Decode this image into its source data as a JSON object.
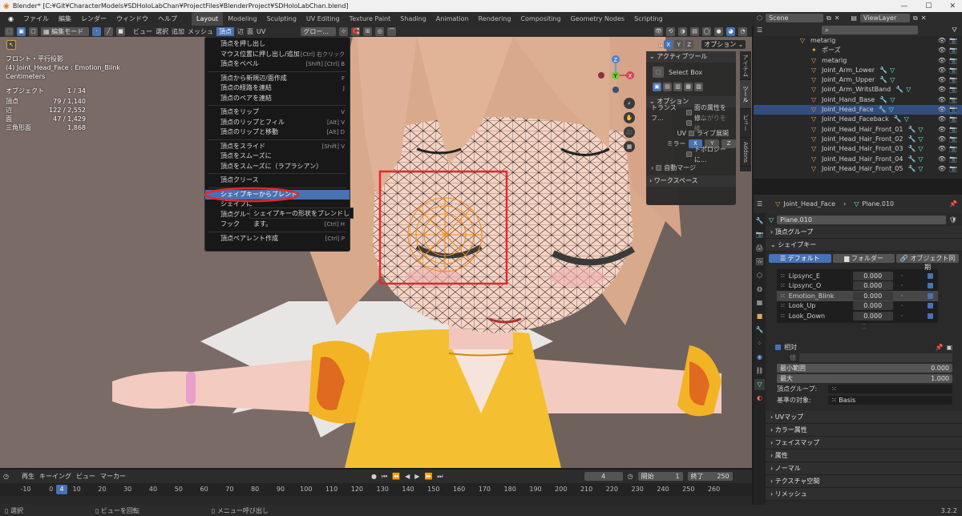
{
  "title": "Blender* [C:¥Git¥CharacterModels¥SDHoloLabChan¥ProjectFiles¥BlenderProject¥SDHoloLabChan.blend]",
  "menu": [
    "ファイル",
    "編集",
    "レンダー",
    "ウィンドウ",
    "ヘルプ"
  ],
  "workspaces": [
    "Layout",
    "Modeling",
    "Sculpting",
    "UV Editing",
    "Texture Paint",
    "Shading",
    "Animation",
    "Rendering",
    "Compositing",
    "Geometry Nodes",
    "Scripting"
  ],
  "active_workspace": "Layout",
  "scene": "Scene",
  "viewlayer": "ViewLayer",
  "viewport_header": {
    "mode": "編集モード",
    "items": [
      "ビュー",
      "選択",
      "追加",
      "メッシュ",
      "頂点",
      "辺",
      "面",
      "UV"
    ],
    "orientation": "グロー...",
    "options": "オプション"
  },
  "viewport_info": {
    "view": "フロント・平行投影",
    "object": "(4) Joint_Head_Face : Emotion_Blink",
    "units": "Centimeters"
  },
  "stats": [
    {
      "label": "オブジェクト",
      "value": "1 / 34"
    },
    {
      "label": "頂点",
      "value": "79 / 1,140"
    },
    {
      "label": "辺",
      "value": "122 / 2,552"
    },
    {
      "label": "面",
      "value": "47 / 1,429"
    },
    {
      "label": "三角形面",
      "value": "1,868"
    }
  ],
  "context_menu": [
    {
      "label": "頂点を押し出し",
      "shortcut": ""
    },
    {
      "label": "マウス位置に押し出し/追加",
      "shortcut": "[Ctrl] 右クリック"
    },
    {
      "label": "頂点をベベル",
      "shortcut": "[Shift] [Ctrl] B"
    },
    {
      "sep": true
    },
    {
      "label": "頂点から新規辺/面作成",
      "shortcut": "F"
    },
    {
      "label": "頂点の経路を連結",
      "shortcut": "J"
    },
    {
      "label": "頂点のペアを連結",
      "shortcut": ""
    },
    {
      "sep": true
    },
    {
      "label": "頂点をリップ",
      "shortcut": "V"
    },
    {
      "label": "頂点のリップとフィル",
      "shortcut": "[Alt] V"
    },
    {
      "label": "頂点のリップと移動",
      "shortcut": "[Alt] D"
    },
    {
      "sep": true
    },
    {
      "label": "頂点をスライド",
      "shortcut": "[Shift] V"
    },
    {
      "label": "頂点をスムーズに",
      "shortcut": ""
    },
    {
      "label": "頂点をスムーズに（ラプラシアン）",
      "shortcut": ""
    },
    {
      "sep": true
    },
    {
      "label": "頂点クリース",
      "shortcut": ""
    },
    {
      "sep": true
    },
    {
      "label": "シェイプキーからブレンド",
      "shortcut": "",
      "selected": true
    },
    {
      "label": "シェイプに",
      "shortcut": ""
    },
    {
      "label": "頂点グルー",
      "shortcut": ""
    },
    {
      "label": "フック",
      "shortcut": "[Ctrl] H"
    },
    {
      "sep": true
    },
    {
      "label": "頂点ペアレント作成",
      "shortcut": "[Ctrl] P"
    }
  ],
  "tooltip": "シェイプキーの形状をブレンドします。",
  "npanel": {
    "active_tool": "アクティブツール",
    "select_box": "Select Box",
    "options": "オプション",
    "transform": "トランスフ...",
    "transform_opt": "面の属性を修...",
    "connected": "つながりを維...",
    "uv": "UV",
    "live_unwrap": "ライブ展開",
    "mirror": "ミラー",
    "x": "X",
    "y": "Y",
    "z": "Z",
    "topology": "トポロジーに...",
    "automerge": "自動マージ",
    "workspace": "ワークスペース"
  },
  "ntabs": [
    "アイテム",
    "ツール",
    "ビュー",
    "Addons"
  ],
  "outliner": [
    {
      "name": "metarig",
      "indent": 2,
      "type": "arm"
    },
    {
      "name": "ポーズ",
      "indent": 3,
      "type": "pose"
    },
    {
      "name": "metarig",
      "indent": 3,
      "type": "arm"
    },
    {
      "name": "Joint_Arm_Lower",
      "indent": 3,
      "type": "bone"
    },
    {
      "name": "Joint_Arm_Upper",
      "indent": 3,
      "type": "bone"
    },
    {
      "name": "Joint_Arm_WritstBand",
      "indent": 3,
      "type": "bone"
    },
    {
      "name": "Joint_Hand_Base",
      "indent": 3,
      "type": "bone"
    },
    {
      "name": "Joint_Head_Face",
      "indent": 3,
      "type": "bone",
      "selected": true
    },
    {
      "name": "Joint_Head_Faceback",
      "indent": 3,
      "type": "bone"
    },
    {
      "name": "Joint_Head_Hair_Front_01",
      "indent": 3,
      "type": "bone"
    },
    {
      "name": "Joint_Head_Hair_Front_02",
      "indent": 3,
      "type": "bone"
    },
    {
      "name": "Joint_Head_Hair_Front_03",
      "indent": 3,
      "type": "bone"
    },
    {
      "name": "Joint_Head_Hair_Front_04",
      "indent": 3,
      "type": "bone"
    },
    {
      "name": "Joint_Head_Hair_Front_05",
      "indent": 3,
      "type": "bone"
    }
  ],
  "props": {
    "breadcrumb_obj": "Joint_Head_Face",
    "breadcrumb_mesh": "Plane.010",
    "mesh_name": "Plane.010",
    "vertex_groups": "頂点グループ",
    "shape_keys": "シェイプキー",
    "sk_tabs": [
      "デフォルト",
      "フォルダー",
      "オブジェクト同期"
    ],
    "shape_key_list": [
      {
        "name": "Lipsync_E",
        "value": "0.000"
      },
      {
        "name": "Lipsync_O",
        "value": "0.000"
      },
      {
        "name": "Emotion_Blink",
        "value": "0.000",
        "selected": true
      },
      {
        "name": "Look_Up",
        "value": "0.000"
      },
      {
        "name": "Look_Down",
        "value": "0.000"
      }
    ],
    "relative": "相対",
    "value_label": "値",
    "min_label": "最小範囲",
    "min_value": "0.000",
    "max_label": "最大",
    "max_value": "1.000",
    "vgroup_label": "頂点グループ:",
    "basis_label": "基準の対象:",
    "basis_value": "Basis",
    "sections": [
      "UVマップ",
      "カラー属性",
      "フェイスマップ",
      "属性",
      "ノーマル",
      "テクスチャ空間",
      "リメッシュ"
    ]
  },
  "timeline": {
    "menu": [
      "再生",
      "キーイング",
      "ビュー",
      "マーカー"
    ],
    "current": "4",
    "start_label": "開始",
    "start": "1",
    "end_label": "終了",
    "end": "250",
    "ticks": [
      "-10",
      "0",
      "10",
      "20",
      "30",
      "40",
      "50",
      "60",
      "70",
      "80",
      "90",
      "100",
      "110",
      "120",
      "130",
      "140",
      "150",
      "160",
      "170",
      "180",
      "190",
      "200",
      "210",
      "220",
      "230",
      "240",
      "250",
      "260"
    ]
  },
  "status": [
    "選択",
    "ビューを回転",
    "メニュー呼び出し"
  ],
  "version": "3.2.2",
  "colors": {
    "accent": "#4772b3",
    "selected_bg": "#334d80",
    "highlight_red": "#e8262c"
  }
}
